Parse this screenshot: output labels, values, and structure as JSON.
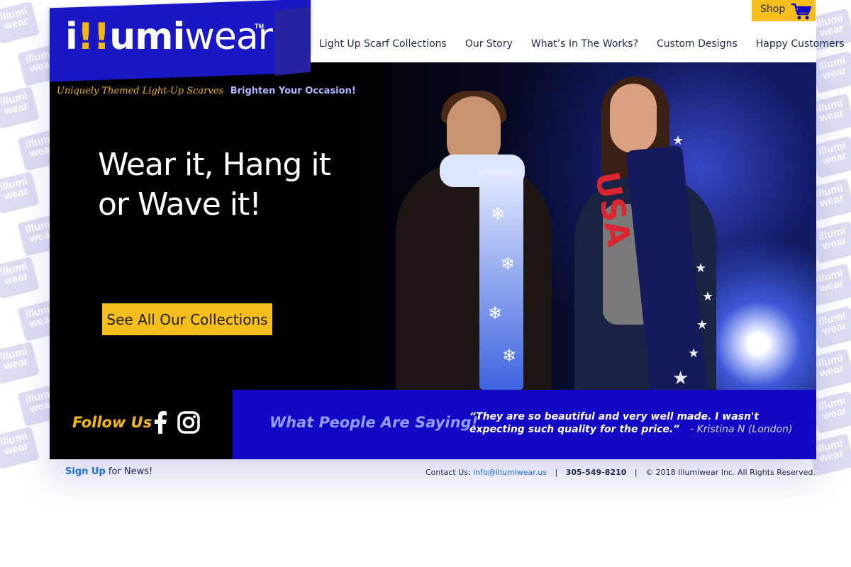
{
  "brand": {
    "logo_part1": "i",
    "logo_part2": "!!",
    "logo_part3": "umi",
    "logo_part4": "wear",
    "trademark": "TM",
    "tagline_script": "Uniquely Themed Light-Up Scarves",
    "tagline_bold": "Brighten Your Occasion!",
    "watermark_line1": "illumi",
    "watermark_line2": "wear"
  },
  "shop": {
    "label": "Shop"
  },
  "nav": {
    "items": [
      "Light Up Scarf Collections",
      "Our Story",
      "What’s In The Works?",
      "Custom Designs",
      "Happy Customers"
    ]
  },
  "hero": {
    "headline_line1": "Wear it, Hang it",
    "headline_line2": "or Wave it!",
    "cta_label": "See All Our Collections",
    "scarf_text": "USA"
  },
  "social": {
    "label": "Follow Us"
  },
  "testimonial": {
    "heading": "What People Are Saying!",
    "quote": "“They are so beautiful and very well made. I wasn't expecting such quality for the price.”",
    "author": "- Kristina N (London)"
  },
  "footer": {
    "signup_bold": "Sign Up",
    "signup_rest": "for News!",
    "contact_label": "Contact Us:",
    "email": "info@illumiwear.us",
    "phone": "305-549-8210",
    "copyright": "© 2018 Illumiwear Inc. All Rights Reserved.",
    "separator": "|"
  },
  "colors": {
    "brand_blue": "#1a17c4",
    "accent_yellow": "#f5be1c",
    "link_blue": "#1c6bd6",
    "nav_text": "#1d2a4a"
  }
}
